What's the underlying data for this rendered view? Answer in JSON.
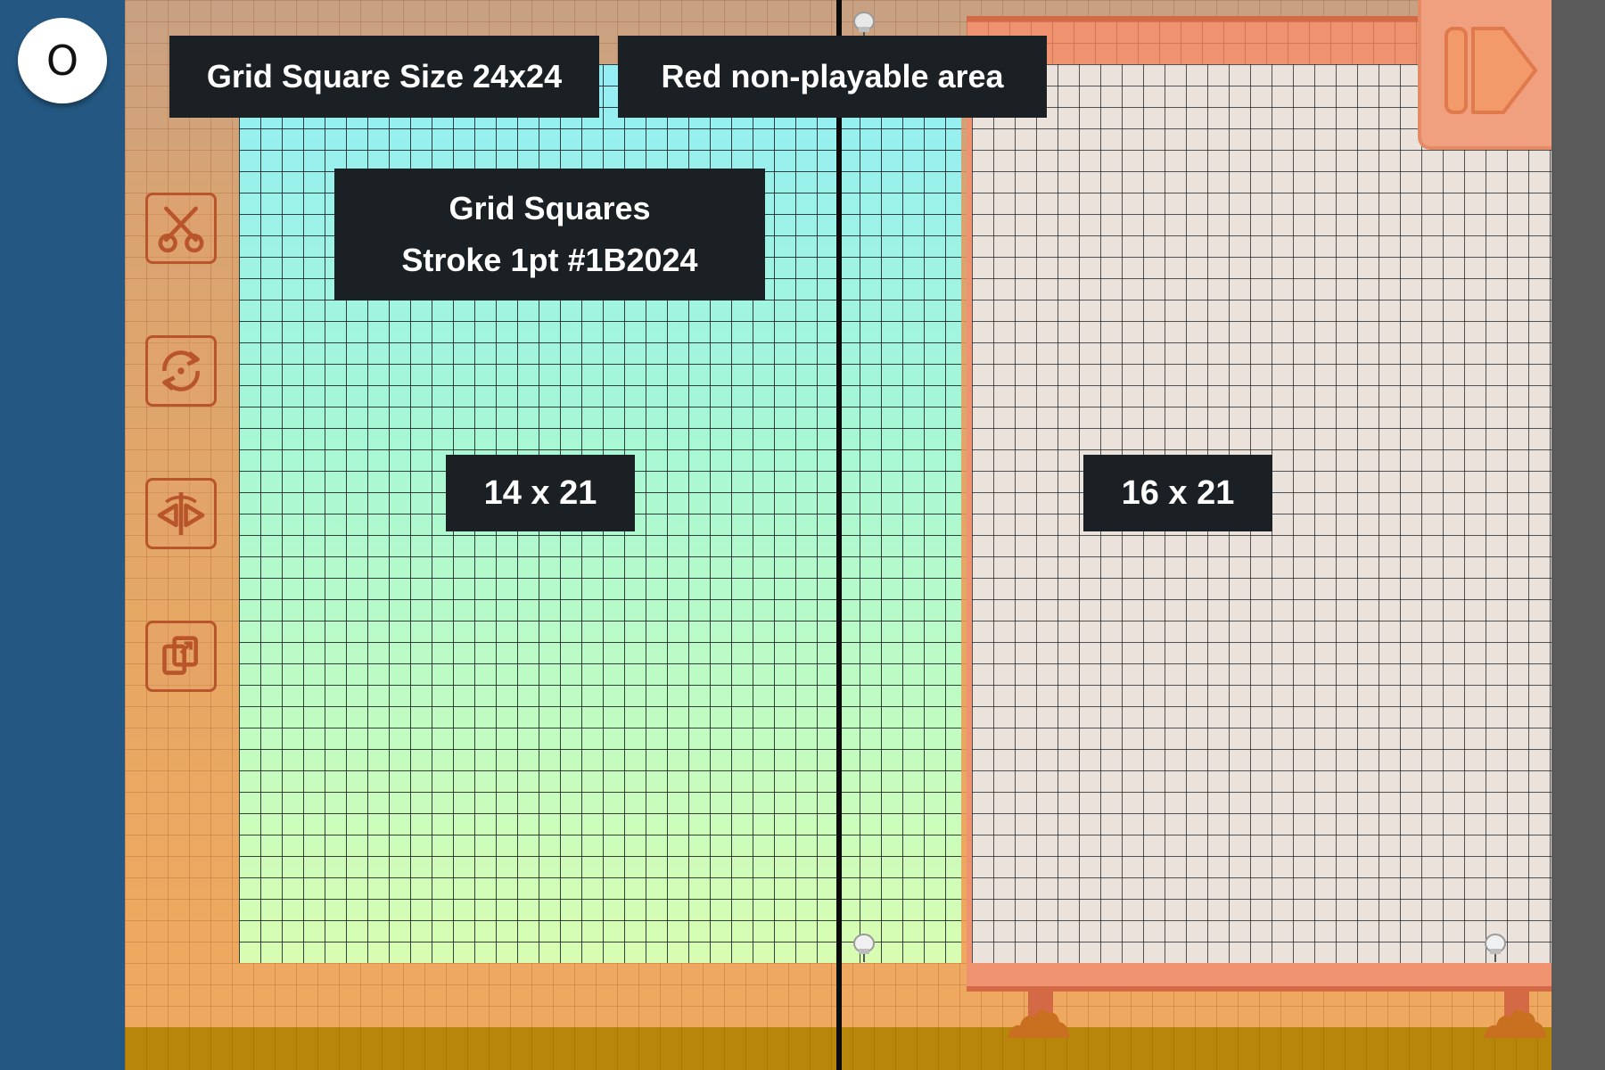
{
  "menu": {
    "o_button_label": "O"
  },
  "labels": {
    "grid_square_size": "Grid Square Size 24x24",
    "red_area": "Red non-playable area",
    "grid_squares_line1": "Grid Squares",
    "grid_squares_line2": "Stroke 1pt #1B2024",
    "left_dims": "14 x 21",
    "right_dims": "16 x 21"
  },
  "toolbar": {
    "tools": [
      {
        "name": "scissors-icon"
      },
      {
        "name": "rotate-icon"
      },
      {
        "name": "flip-icon"
      },
      {
        "name": "copy-icon"
      }
    ]
  },
  "icons": {
    "next": "skip-next-icon",
    "pin": "pushpin-icon"
  },
  "colors": {
    "grid_stroke": "#1B2024",
    "label_bg": "#1b2024",
    "left_rail": "#245882",
    "right_rail": "#5a5a5a",
    "board": "#ef9270",
    "tool_stroke": "#b9552b",
    "ground": "#b8860a"
  }
}
